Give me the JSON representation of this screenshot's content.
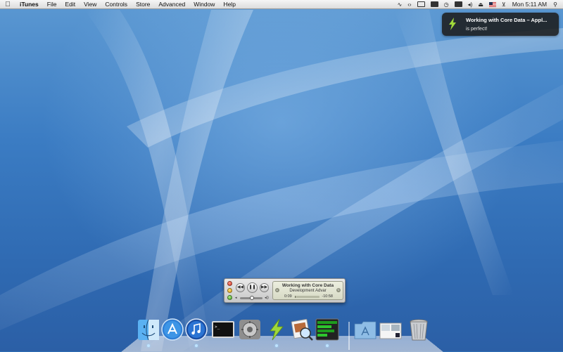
{
  "menubar": {
    "app_name": "iTunes",
    "menus": [
      "File",
      "Edit",
      "View",
      "Controls",
      "Store",
      "Advanced",
      "Window",
      "Help"
    ],
    "clock": "Mon 5:11 AM",
    "extras": [
      "activity-monitor-icon",
      "script-icon",
      "display-icon",
      "battery-icon",
      "time-machine-icon",
      "screen-icon",
      "volume-icon",
      "eject-icon",
      "flag-icon",
      "wifi-icon",
      "spotlight-icon"
    ]
  },
  "notification": {
    "title": "Working with Core Data – Appl...",
    "body": "is perfect!",
    "icon": "lightning-icon",
    "accent": "#9fd83a"
  },
  "mini_player": {
    "track_title": "Working with Core Data",
    "track_album": "Development Advar",
    "elapsed": "0:09",
    "remaining": "-10:58",
    "progress": 0.014,
    "volume": 0.55
  },
  "dock": {
    "items": [
      {
        "name": "finder-icon",
        "running": true
      },
      {
        "name": "app-store-icon",
        "running": false
      },
      {
        "name": "itunes-icon",
        "running": true
      },
      {
        "name": "terminal-icon",
        "running": false
      },
      {
        "name": "system-preferences-icon",
        "running": false
      },
      {
        "name": "reeder-lightning-icon",
        "running": true
      },
      {
        "name": "preview-icon",
        "running": false
      },
      {
        "name": "activity-monitor-icon",
        "running": true
      }
    ],
    "stacks": [
      {
        "name": "applications-folder-icon"
      },
      {
        "name": "documents-stack-icon"
      },
      {
        "name": "trash-icon"
      }
    ]
  }
}
